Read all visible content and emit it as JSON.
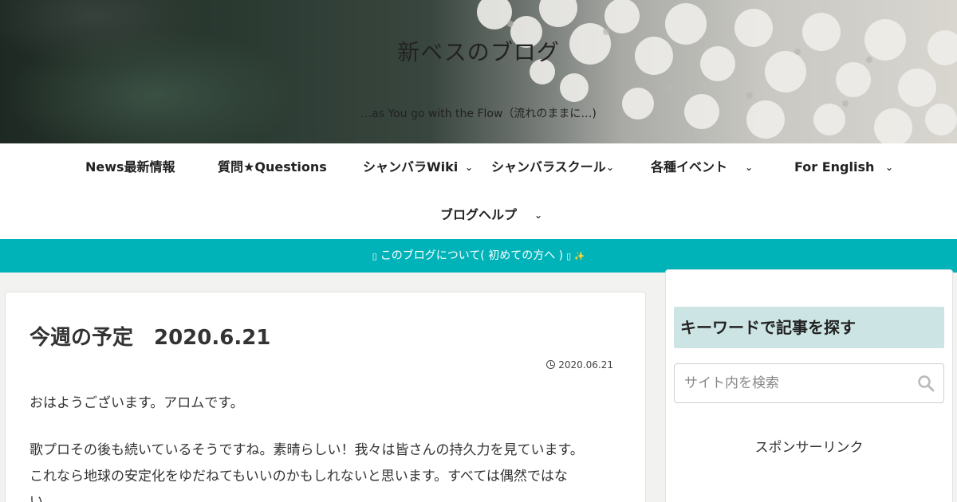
{
  "header": {
    "title": "新ベスのブログ",
    "subtitle": "…as You go with the Flow（流れのままに…)"
  },
  "nav": {
    "items": [
      {
        "label": "News最新情報"
      },
      {
        "label": "質問★Questions"
      },
      {
        "label": "シャンバラWiki",
        "dropdown": true
      },
      {
        "label": "シャンバラスクール",
        "dropdown": true
      },
      {
        "label": "各種イベント",
        "dropdown": true
      },
      {
        "label": "For English",
        "dropdown": true
      },
      {
        "label": "ブログヘルプ",
        "dropdown": true
      }
    ],
    "chevron": "⌄"
  },
  "notice": {
    "text": "このブログについて( 初めての方へ )",
    "icon_left": "▯",
    "icon_right": "▯ ✨",
    "color": "#00b3b9"
  },
  "article": {
    "title": "今週の予定　2020.6.21",
    "date": "2020.06.21",
    "paragraphs": [
      "おはようございます。アロムです。",
      "歌プロその後も続いているそうですね。素晴らしい！我々は皆さんの持久力を見ています。",
      "これなら地球の安定化をゆだねてもいいのかもしれないと思います。すべては偶然ではな",
      "い。"
    ]
  },
  "sidebar": {
    "widget_title": "キーワードで記事を探す",
    "search_placeholder": "サイト内を検索",
    "sponsor_label": "スポンサーリンク",
    "title_bg": "#cce4e3"
  }
}
